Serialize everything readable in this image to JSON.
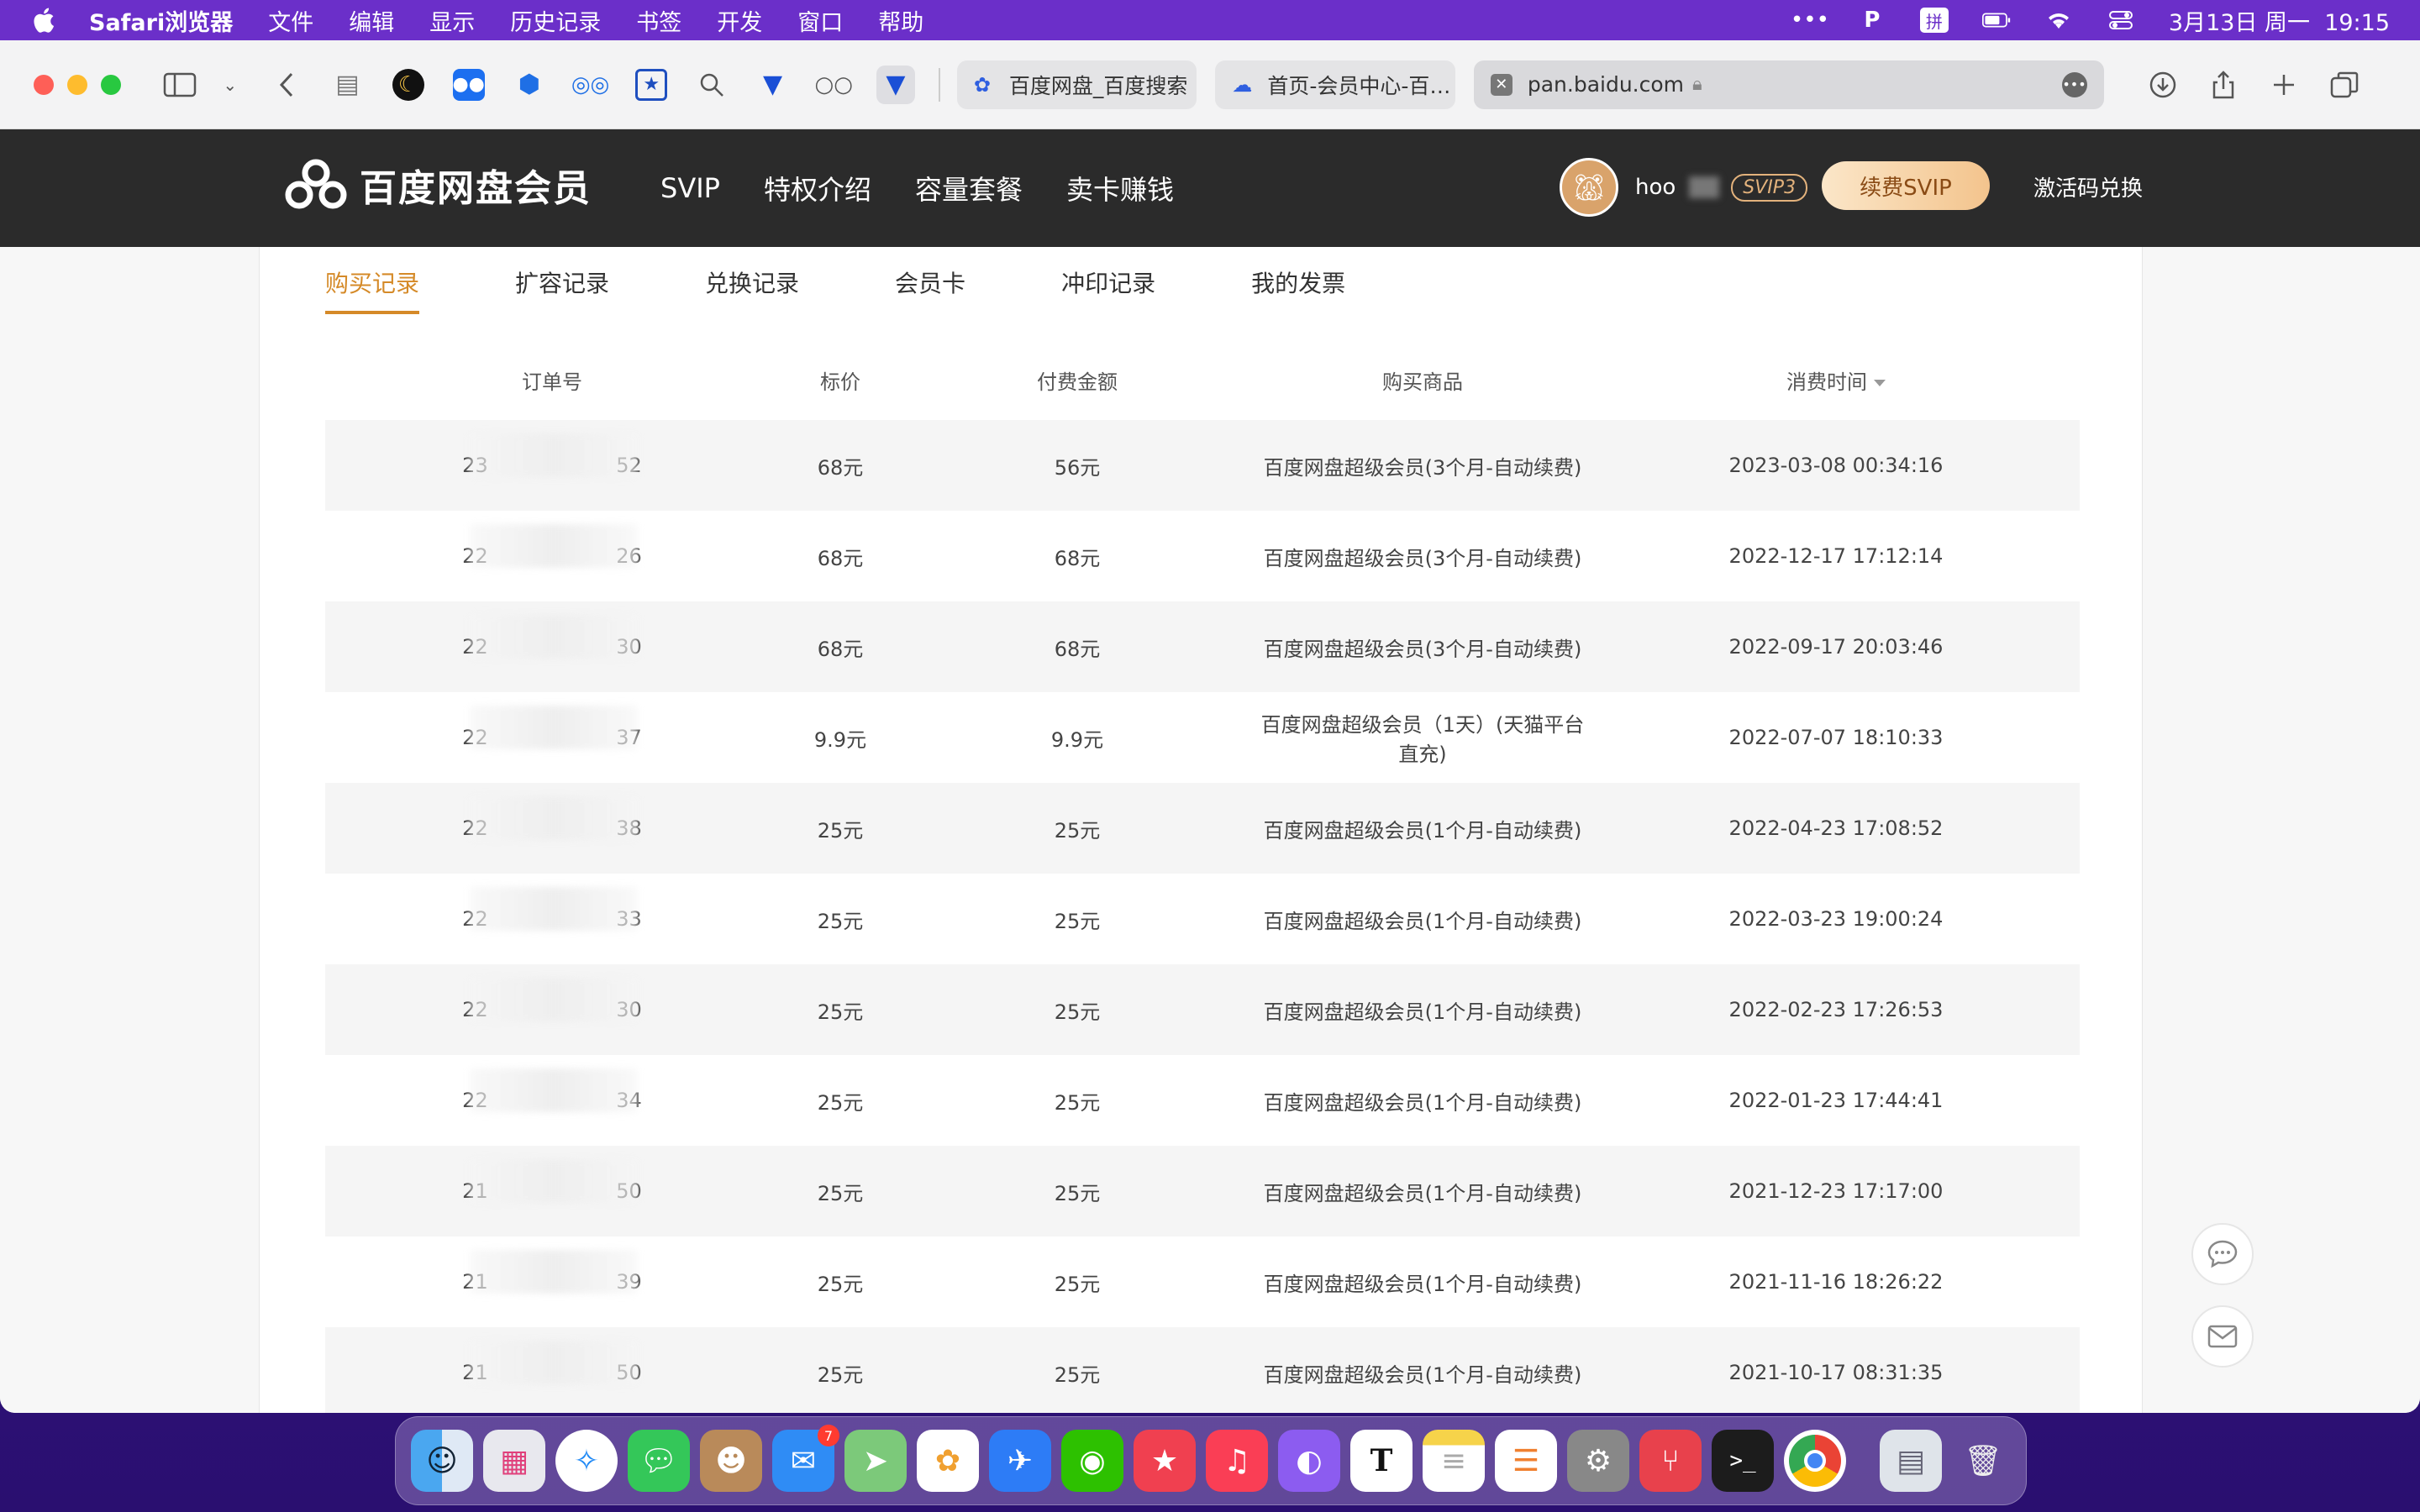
{
  "menubar": {
    "app": "Safari浏览器",
    "items": [
      "文件",
      "编辑",
      "显示",
      "历史记录",
      "书签",
      "开发",
      "窗口",
      "帮助"
    ],
    "datetime": "3月13日 周一  19:15"
  },
  "browser": {
    "tabs": [
      {
        "title": "百度网盘_百度搜索"
      },
      {
        "title": "首页-会员中心-百…"
      }
    ],
    "address": "pan.baidu.com"
  },
  "header": {
    "brand": "百度网盘会员",
    "nav": [
      "SVIP",
      "特权介绍",
      "容量套餐",
      "卖卡赚钱"
    ],
    "username": "hoo",
    "badge": "SVIP3",
    "renew_label": "续费SVIP",
    "activate_label": "激活码兑换"
  },
  "subtabs": [
    "购买记录",
    "扩容记录",
    "兑换记录",
    "会员卡",
    "冲印记录",
    "我的发票"
  ],
  "table": {
    "headers": [
      "订单号",
      "标价",
      "付费金额",
      "购买商品",
      "消费时间"
    ],
    "rows": [
      {
        "order": "23                    52",
        "price": "68元",
        "paid": "56元",
        "product": "百度网盘超级会员(3个月-自动续费)",
        "time": "2023-03-08 00:34:16"
      },
      {
        "order": "22                    26",
        "price": "68元",
        "paid": "68元",
        "product": "百度网盘超级会员(3个月-自动续费)",
        "time": "2022-12-17 17:12:14"
      },
      {
        "order": "22                    30",
        "price": "68元",
        "paid": "68元",
        "product": "百度网盘超级会员(3个月-自动续费)",
        "time": "2022-09-17 20:03:46"
      },
      {
        "order": "22                    37",
        "price": "9.9元",
        "paid": "9.9元",
        "product": "百度网盘超级会员（1天）(天猫平台直充)",
        "time": "2022-07-07 18:10:33"
      },
      {
        "order": "22                    38",
        "price": "25元",
        "paid": "25元",
        "product": "百度网盘超级会员(1个月-自动续费)",
        "time": "2022-04-23 17:08:52"
      },
      {
        "order": "22                    33",
        "price": "25元",
        "paid": "25元",
        "product": "百度网盘超级会员(1个月-自动续费)",
        "time": "2022-03-23 19:00:24"
      },
      {
        "order": "22                    30",
        "price": "25元",
        "paid": "25元",
        "product": "百度网盘超级会员(1个月-自动续费)",
        "time": "2022-02-23 17:26:53"
      },
      {
        "order": "22                    34",
        "price": "25元",
        "paid": "25元",
        "product": "百度网盘超级会员(1个月-自动续费)",
        "time": "2022-01-23 17:44:41"
      },
      {
        "order": "21                    50",
        "price": "25元",
        "paid": "25元",
        "product": "百度网盘超级会员(1个月-自动续费)",
        "time": "2021-12-23 17:17:00"
      },
      {
        "order": "21                    39",
        "price": "25元",
        "paid": "25元",
        "product": "百度网盘超级会员(1个月-自动续费)",
        "time": "2021-11-16 18:26:22"
      },
      {
        "order": "21                    50",
        "price": "25元",
        "paid": "25元",
        "product": "百度网盘超级会员(1个月-自动续费)",
        "time": "2021-10-17 08:31:35"
      }
    ]
  },
  "dock": {
    "mail_badge": "7",
    "apps": [
      "finder-icon",
      "launchpad-icon",
      "safari-icon",
      "messages-icon",
      "contacts-icon",
      "mail-icon",
      "maps-icon",
      "photos-icon",
      "feishu-icon",
      "wechat-icon",
      "bookmark-icon",
      "music-icon",
      "github-icon",
      "typora-icon",
      "notes-icon",
      "reminders-icon",
      "settings-icon",
      "xmind-icon",
      "terminal-icon",
      "chrome-icon"
    ]
  }
}
